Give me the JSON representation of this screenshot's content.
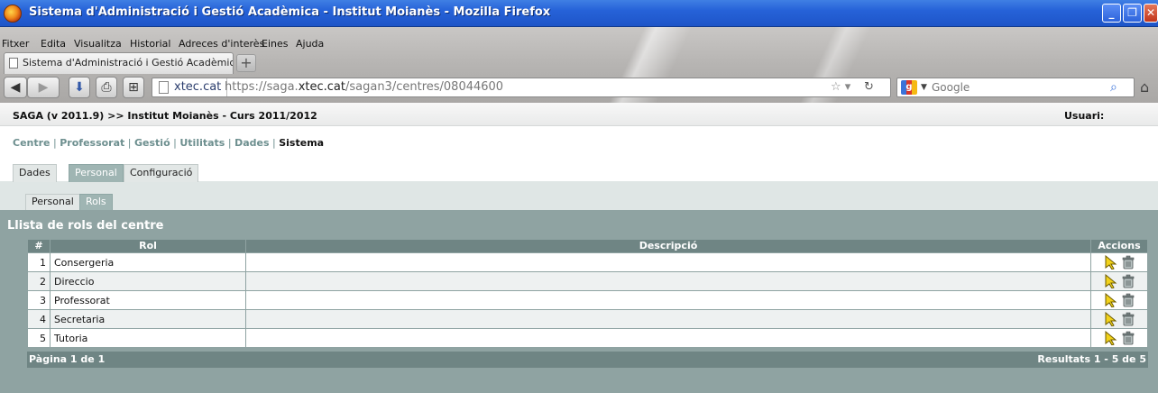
{
  "browser": {
    "window_title": "Sistema d'Administració i Gestió Acadèmica - Institut Moianès - Mozilla Firefox",
    "menu": [
      "Fitxer",
      "Edita",
      "Visualitza",
      "Historial",
      "Adreces d'interès",
      "Eines",
      "Ajuda"
    ],
    "tab_title": "Sistema d'Administració i Gestió Acadèmica - ...",
    "url_domain": "xtec.cat",
    "url_prefix": "https://saga.",
    "url_host_bold": "xtec.cat",
    "url_rest": "/sagan3/centres/08044600",
    "search_placeholder": "Google",
    "icons": {
      "back": "back-arrow-icon",
      "forward": "forward-arrow-icon",
      "download": "download-icon",
      "print": "print-icon",
      "newtab": "add-tab-icon",
      "bookmark": "star-icon",
      "reload": "reload-icon",
      "search": "magnifier-icon",
      "home": "home-icon"
    }
  },
  "saga": {
    "header_title": "SAGA (v 2011.9) >> Institut Moianès - Curs 2011/2012",
    "user_label": "Usuari:",
    "main_nav": [
      {
        "label": "Centre",
        "current": false
      },
      {
        "label": "Professorat",
        "current": false
      },
      {
        "label": "Gestió",
        "current": false
      },
      {
        "label": "Utilitats",
        "current": false
      },
      {
        "label": "Dades",
        "current": false
      },
      {
        "label": "Sistema",
        "current": true
      }
    ],
    "nav_separator": "|",
    "subtabs": [
      {
        "label": "Dades",
        "active": false
      },
      {
        "label": "Personal",
        "active": true
      },
      {
        "label": "Configuració",
        "active": false
      }
    ],
    "subsubtabs": [
      {
        "label": "Personal",
        "active": false
      },
      {
        "label": "Rols",
        "active": true
      }
    ],
    "panel_title": "Llista de rols del centre",
    "table": {
      "columns": [
        "#",
        "Rol",
        "Descripció",
        "Accions"
      ],
      "rows": [
        {
          "num": "1",
          "rol": "Consergeria",
          "descripcio": ""
        },
        {
          "num": "2",
          "rol": "Direccio",
          "descripcio": ""
        },
        {
          "num": "3",
          "rol": "Professorat",
          "descripcio": ""
        },
        {
          "num": "4",
          "rol": "Secretaria",
          "descripcio": ""
        },
        {
          "num": "5",
          "rol": "Tutoria",
          "descripcio": ""
        }
      ],
      "action_icons": [
        "edit-pointer-icon",
        "trash-icon"
      ]
    },
    "footer_page": "Pàgina 1 de 1",
    "footer_results": "Resultats 1 - 5 de 5"
  }
}
